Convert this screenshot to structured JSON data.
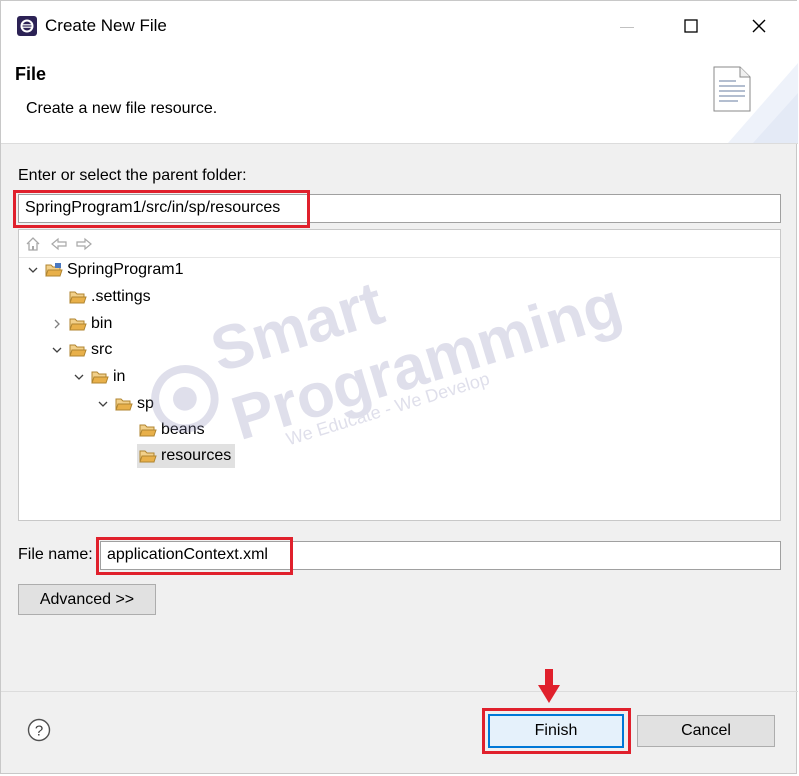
{
  "window": {
    "title": "Create New File",
    "controls": {
      "minimize": "—",
      "maximize": "☐",
      "close": "✕"
    }
  },
  "header": {
    "title": "File",
    "description": "Create a new file resource."
  },
  "parent_folder": {
    "label": "Enter or select the parent folder:",
    "value": "SpringProgram1/src/in/sp/resources"
  },
  "tree": {
    "items": [
      {
        "label": "SpringProgram1",
        "expanded": true
      },
      {
        "label": ".settings"
      },
      {
        "label": "bin",
        "expanded": false
      },
      {
        "label": "src",
        "expanded": true
      },
      {
        "label": "in",
        "expanded": true
      },
      {
        "label": "sp",
        "expanded": true
      },
      {
        "label": "beans"
      },
      {
        "label": "resources",
        "selected": true
      }
    ]
  },
  "file_name": {
    "label": "File name:",
    "value": "applicationContext.xml"
  },
  "buttons": {
    "advanced": "Advanced >>",
    "finish": "Finish",
    "cancel": "Cancel",
    "help": "?"
  },
  "watermark": {
    "brand": "Smart Programming",
    "tagline": "We Educate - We Develop"
  },
  "colors": {
    "highlight": "#e0202c",
    "folder": "#e8b04a",
    "selection": "#e1e1e1"
  }
}
